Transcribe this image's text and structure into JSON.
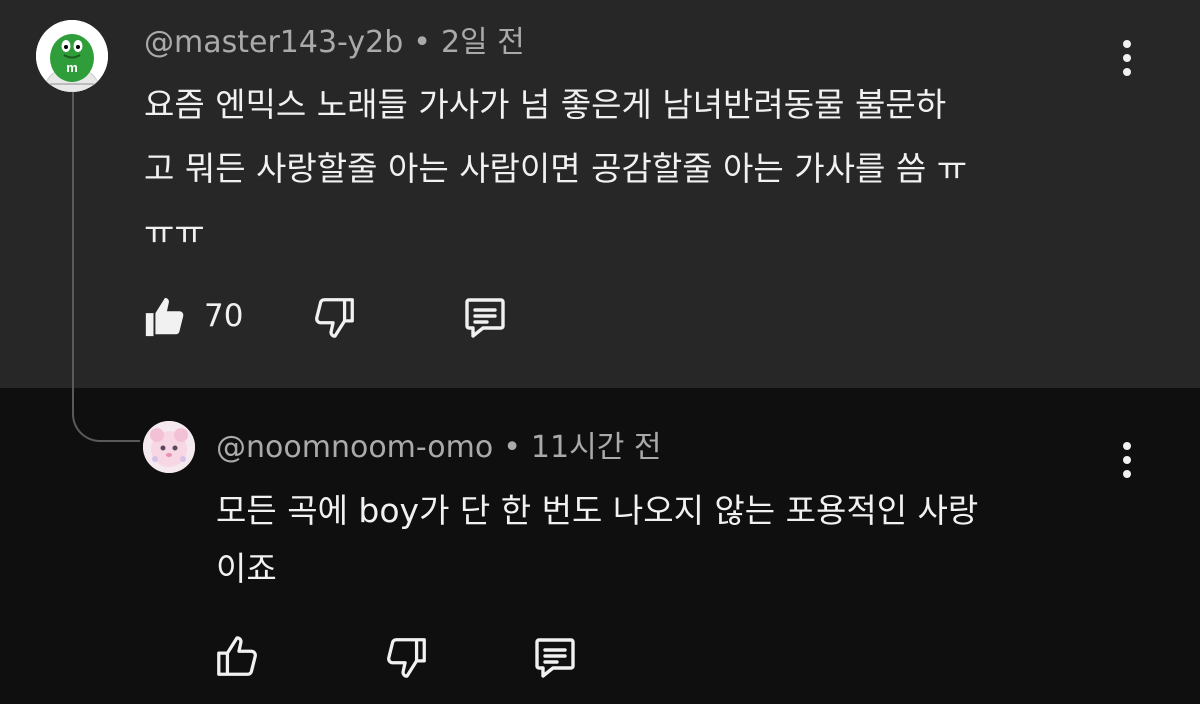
{
  "comments": [
    {
      "author": "@master143-y2b",
      "separator": "•",
      "time": "2일 전",
      "lines": [
        "요즘 엔믹스 노래들 가사가 넘 좋은게 남녀반려동물 불문하",
        "고 뭐든 사랑할줄 아는 사람이면 공감할줄 아는 가사를 씀 ㅠ",
        "ㅠㅠ"
      ],
      "likes": "70",
      "avatar_icon": "green-mm-character-icon"
    },
    {
      "author": "@noomnoom-omo",
      "separator": "•",
      "time": "11시간 전",
      "lines": [
        "모든 곡에 boy가 단 한 번도 나오지 않는 포용적인 사랑",
        "이죠"
      ],
      "avatar_icon": "pink-plush-character-icon"
    }
  ],
  "colors": {
    "main_bg": "#272727",
    "reply_bg": "#0f0f0f",
    "text": "#f1f1f1",
    "meta": "#aaaaaa"
  }
}
